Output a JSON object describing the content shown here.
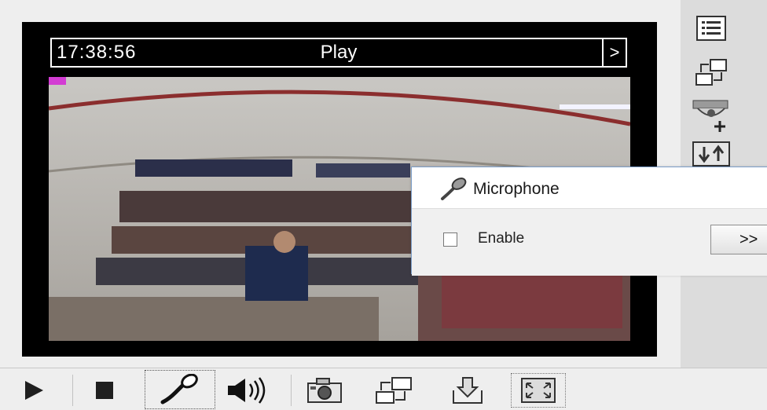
{
  "viewer": {
    "time": "17:38:56",
    "mode": "Play",
    "more_label": ">"
  },
  "microphone_panel": {
    "title": "Microphone",
    "enable_label": "Enable",
    "enabled": false,
    "expand_label": ">>"
  },
  "sidebar": {
    "buttons": [
      "list-icon",
      "switch-stream-icon",
      "ptz-camera-icon",
      "download-upload-icon"
    ]
  },
  "toolbar": {
    "buttons": [
      "play-icon",
      "stop-icon",
      "microphone-icon",
      "speaker-icon",
      "snapshot-icon",
      "switch-stream-icon",
      "record-icon",
      "fullscreen-icon"
    ],
    "active": "microphone-icon"
  },
  "colors": {
    "viewer_bg": "#000000",
    "panel_border": "#7a9cc7",
    "toolbar_bg": "#eeeeee"
  }
}
